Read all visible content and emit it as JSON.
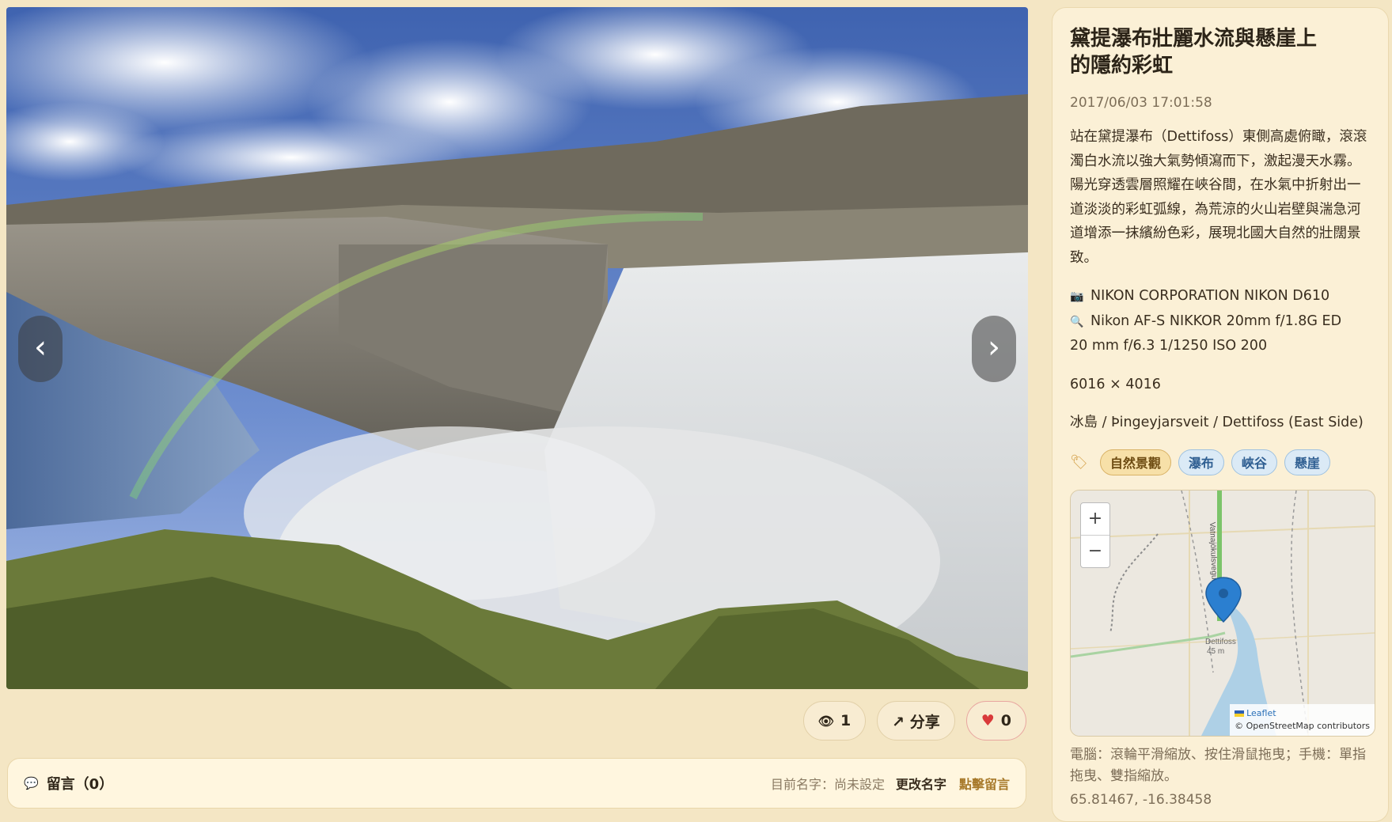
{
  "viewer": {
    "prev_label": "‹",
    "next_label": "›"
  },
  "actions": {
    "views_icon": "eye-icon",
    "views": "1",
    "share_label": "↗ 分享",
    "like_icon": "heart-icon",
    "likes": "0"
  },
  "comments": {
    "title": "留言（0）",
    "name_status": "目前名字：尚未設定",
    "rename_label": "更改名字",
    "comment_label": "點擊留言"
  },
  "panel": {
    "title": "黛提瀑布壯麗水流與懸崖上的隱約彩虹",
    "date": "2017/06/03 17:01:58",
    "description": "站在黛提瀑布（Dettifoss）東側高處俯瞰，滾滾濁白水流以強大氣勢傾瀉而下，激起漫天水霧。陽光穿透雲層照耀在峽谷間，在水氣中折射出一道淡淡的彩虹弧線，為荒涼的火山岩壁與湍急河道增添一抹繽紛色彩，展現北國大自然的壯闊景致。",
    "camera": "NIKON CORPORATION NIKON D610",
    "lens": "Nikon AF-S NIKKOR 20mm f/1.8G ED",
    "exposure": "20 mm f/6.3 1/1250 ISO 200",
    "size": "6016 × 4016",
    "location": "冰島 / Þingeyjarsveit / Dettifoss (East Side)",
    "tags": [
      "自然景觀",
      "瀑布",
      "峽谷",
      "懸崖"
    ],
    "map": {
      "zoom_in": "+",
      "zoom_out": "−",
      "leaflet_label": "Leaflet",
      "attribution": "© OpenStreetMap contributors",
      "road_label": "Vatnajökulsvegur",
      "place_label": "Dettifoss",
      "elevation_label": "45 m"
    },
    "hint": "電腦：滾輪平滑縮放、按住滑鼠拖曳；手機：單指拖曳、雙指縮放。",
    "coords": "65.81467, -16.38458"
  },
  "colors": {
    "background": "#f4e6c4",
    "tag_gold": "#f7e0a8",
    "tag_blue": "#dbeaf6",
    "heart": "#d93a3a"
  }
}
